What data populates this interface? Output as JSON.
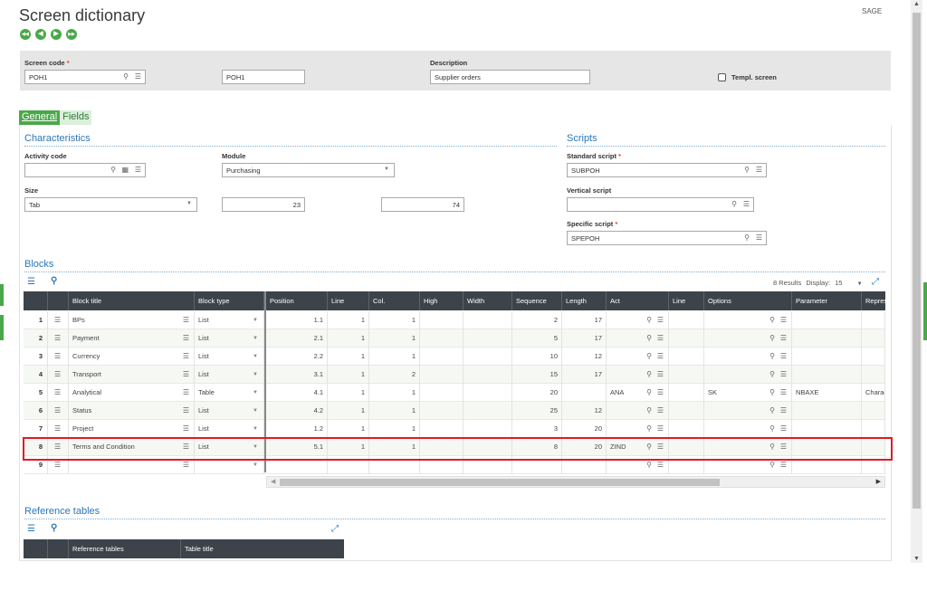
{
  "page": {
    "title": "Screen dictionary",
    "company": "SAGE"
  },
  "nav_buttons": [
    "◀◀",
    "◀",
    "▶",
    "▶▶"
  ],
  "header": {
    "screen_code_label": "Screen code",
    "screen_code_value": "POH1",
    "screen_code2_value": "POH1",
    "description_label": "Description",
    "description_value": "Supplier orders",
    "templ_screen_label": "Templ. screen"
  },
  "tabs": [
    {
      "label": "General",
      "active": true
    },
    {
      "label": "Fields",
      "active": false
    }
  ],
  "characteristics": {
    "title": "Characteristics",
    "activity_code_label": "Activity code",
    "activity_code_value": "",
    "module_label": "Module",
    "module_value": "Purchasing",
    "size_label": "Size",
    "size_value": "Tab",
    "size_num1": "23",
    "size_num2": "74"
  },
  "scripts": {
    "title": "Scripts",
    "standard_label": "Standard script",
    "standard_value": "SUBPOH",
    "vertical_label": "Vertical script",
    "vertical_value": "",
    "specific_label": "Specific script",
    "specific_value": "SPEPOH"
  },
  "blocks": {
    "title": "Blocks",
    "results_text": "8 Results",
    "display_label": "Display:",
    "display_value": "15",
    "columns": [
      "Block title",
      "Block type",
      "Position",
      "Line",
      "Col.",
      "High",
      "Width",
      "Sequence",
      "Length",
      "Act",
      "Line",
      "Options",
      "Parameter",
      "Repres"
    ],
    "rows": [
      {
        "n": "1",
        "title": "BPs",
        "type": "List",
        "position": "1.1",
        "line": "1",
        "col": "1",
        "high": "",
        "width": "",
        "sequence": "2",
        "length": "17",
        "act": "",
        "line2": "",
        "options": "",
        "parameter": "",
        "repres": ""
      },
      {
        "n": "2",
        "title": "Payment",
        "type": "List",
        "position": "2.1",
        "line": "1",
        "col": "1",
        "high": "",
        "width": "",
        "sequence": "5",
        "length": "17",
        "act": "",
        "line2": "",
        "options": "",
        "parameter": "",
        "repres": ""
      },
      {
        "n": "3",
        "title": "Currency",
        "type": "List",
        "position": "2.2",
        "line": "1",
        "col": "1",
        "high": "",
        "width": "",
        "sequence": "10",
        "length": "12",
        "act": "",
        "line2": "",
        "options": "",
        "parameter": "",
        "repres": ""
      },
      {
        "n": "4",
        "title": "Transport",
        "type": "List",
        "position": "3.1",
        "line": "1",
        "col": "2",
        "high": "",
        "width": "",
        "sequence": "15",
        "length": "17",
        "act": "",
        "line2": "",
        "options": "",
        "parameter": "",
        "repres": ""
      },
      {
        "n": "5",
        "title": "Analytical",
        "type": "Table",
        "position": "4.1",
        "line": "1",
        "col": "1",
        "high": "",
        "width": "",
        "sequence": "20",
        "length": "",
        "act": "ANA",
        "line2": "",
        "options": "SK",
        "parameter": "NBAXE",
        "repres": "Charac"
      },
      {
        "n": "6",
        "title": "Status",
        "type": "List",
        "position": "4.2",
        "line": "1",
        "col": "1",
        "high": "",
        "width": "",
        "sequence": "25",
        "length": "12",
        "act": "",
        "line2": "",
        "options": "",
        "parameter": "",
        "repres": ""
      },
      {
        "n": "7",
        "title": "Project",
        "type": "List",
        "position": "1.2",
        "line": "1",
        "col": "1",
        "high": "",
        "width": "",
        "sequence": "3",
        "length": "20",
        "act": "",
        "line2": "",
        "options": "",
        "parameter": "",
        "repres": ""
      },
      {
        "n": "8",
        "title": "Terms and Condition",
        "type": "List",
        "position": "5.1",
        "line": "1",
        "col": "1",
        "high": "",
        "width": "",
        "sequence": "8",
        "length": "20",
        "act": "ZIND",
        "line2": "",
        "options": "",
        "parameter": "",
        "repres": ""
      },
      {
        "n": "9",
        "title": "",
        "type": "",
        "position": "",
        "line": "",
        "col": "",
        "high": "",
        "width": "",
        "sequence": "",
        "length": "",
        "act": "",
        "line2": "",
        "options": "",
        "parameter": "",
        "repres": ""
      }
    ]
  },
  "reference_tables": {
    "title": "Reference tables",
    "columns": [
      "Reference tables",
      "Table title"
    ]
  },
  "colors": {
    "accent_green": "#4aa84a",
    "section_blue": "#2a77b8",
    "header_dark": "#3d434b",
    "highlight_red": "#e11b22"
  },
  "icons": {
    "search": "⚲",
    "list": "☰",
    "calendar": "▦",
    "expand": "⤢",
    "dropdown": "▼"
  }
}
